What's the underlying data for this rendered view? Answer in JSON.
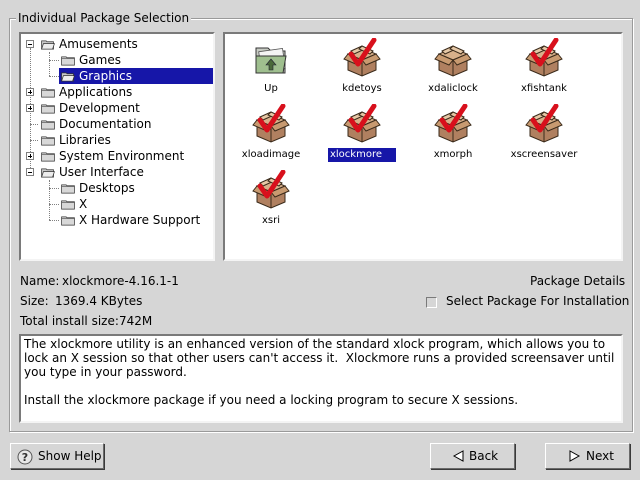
{
  "group_title": "Individual Package Selection",
  "tree": {
    "items": [
      {
        "label": "Amusements",
        "level": 0,
        "expander": "minus",
        "open": true,
        "selected": false
      },
      {
        "label": "Games",
        "level": 1,
        "expander": "",
        "open": false,
        "selected": false
      },
      {
        "label": "Graphics",
        "level": 1,
        "expander": "",
        "open": true,
        "selected": true
      },
      {
        "label": "Applications",
        "level": 0,
        "expander": "plus",
        "open": false,
        "selected": false
      },
      {
        "label": "Development",
        "level": 0,
        "expander": "plus",
        "open": false,
        "selected": false
      },
      {
        "label": "Documentation",
        "level": 0,
        "expander": "",
        "open": false,
        "selected": false
      },
      {
        "label": "Libraries",
        "level": 0,
        "expander": "",
        "open": false,
        "selected": false
      },
      {
        "label": "System Environment",
        "level": 0,
        "expander": "plus",
        "open": false,
        "selected": false
      },
      {
        "label": "User Interface",
        "level": 0,
        "expander": "minus",
        "open": true,
        "selected": false
      },
      {
        "label": "Desktops",
        "level": 1,
        "expander": "",
        "open": false,
        "selected": false
      },
      {
        "label": "X",
        "level": 1,
        "expander": "",
        "open": false,
        "selected": false
      },
      {
        "label": "X Hardware Support",
        "level": 1,
        "expander": "",
        "open": false,
        "selected": false
      }
    ]
  },
  "packages": {
    "items": [
      {
        "label": "Up",
        "icon": "folder-up-icon",
        "selected": false
      },
      {
        "label": "kdetoys",
        "icon": "package-checked-icon",
        "selected": false
      },
      {
        "label": "xdaliclock",
        "icon": "package-unchecked-icon",
        "selected": false
      },
      {
        "label": "xfishtank",
        "icon": "package-checked-icon",
        "selected": false
      },
      {
        "label": "xloadimage",
        "icon": "package-checked-icon",
        "selected": false
      },
      {
        "label": "xlockmore",
        "icon": "package-checked-icon",
        "selected": true
      },
      {
        "label": "xmorph",
        "icon": "package-checked-icon",
        "selected": false
      },
      {
        "label": "xscreensaver",
        "icon": "package-checked-icon",
        "selected": false
      },
      {
        "label": "xsri",
        "icon": "package-checked-icon",
        "selected": false
      }
    ]
  },
  "details": {
    "name_label": "Name:",
    "name_value": "xlockmore-4.16.1-1",
    "size_label": "Size:",
    "size_value": "1369.4 KBytes",
    "total_label": "Total install size:",
    "total_value": "742M",
    "package_details_title": "Package Details",
    "select_label": "Select Package For Installation",
    "select_checked": false
  },
  "description": {
    "text": "The xlockmore utility is an enhanced version of the standard xlock program, which allows you to lock an X session so that other users can't access it.  Xlockmore runs a provided screensaver until you type in your password.\n\nInstall the xlockmore package if you need a locking program to secure X sessions."
  },
  "buttons": {
    "help": "Show Help",
    "back": "Back",
    "next": "Next"
  },
  "colors": {
    "selection": "#1616a8",
    "check": "#d8101c",
    "box": "#b08060"
  }
}
